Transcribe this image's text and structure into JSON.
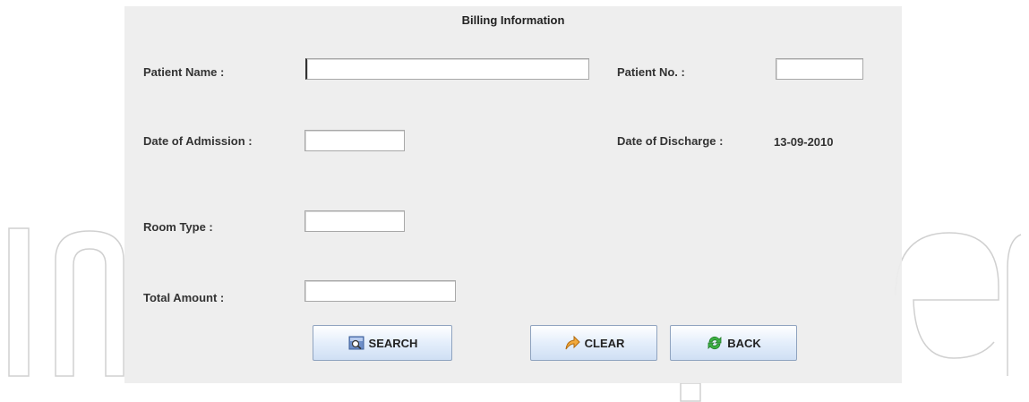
{
  "form": {
    "title": "Billing Information",
    "patient_name_label": "Patient Name :",
    "patient_name_value": "",
    "patient_no_label": "Patient No. :",
    "patient_no_value": "",
    "admission_label": "Date of Admission :",
    "admission_value": "",
    "discharge_label": "Date of Discharge :",
    "discharge_value": "13-09-2010",
    "room_type_label": "Room Type :",
    "room_type_value": "",
    "total_amount_label": "Total Amount :",
    "total_amount_value": ""
  },
  "buttons": {
    "search_label": "SEARCH",
    "search_icon": "search-icon",
    "clear_label": "CLEAR",
    "clear_icon": "clear-arrow-icon",
    "back_label": "BACK",
    "back_icon": "refresh-icon"
  },
  "colors": {
    "panel_bg": "#ededed",
    "button_top": "#ffffff",
    "button_bottom": "#cfdff4",
    "button_border": "#8fa3bf"
  }
}
